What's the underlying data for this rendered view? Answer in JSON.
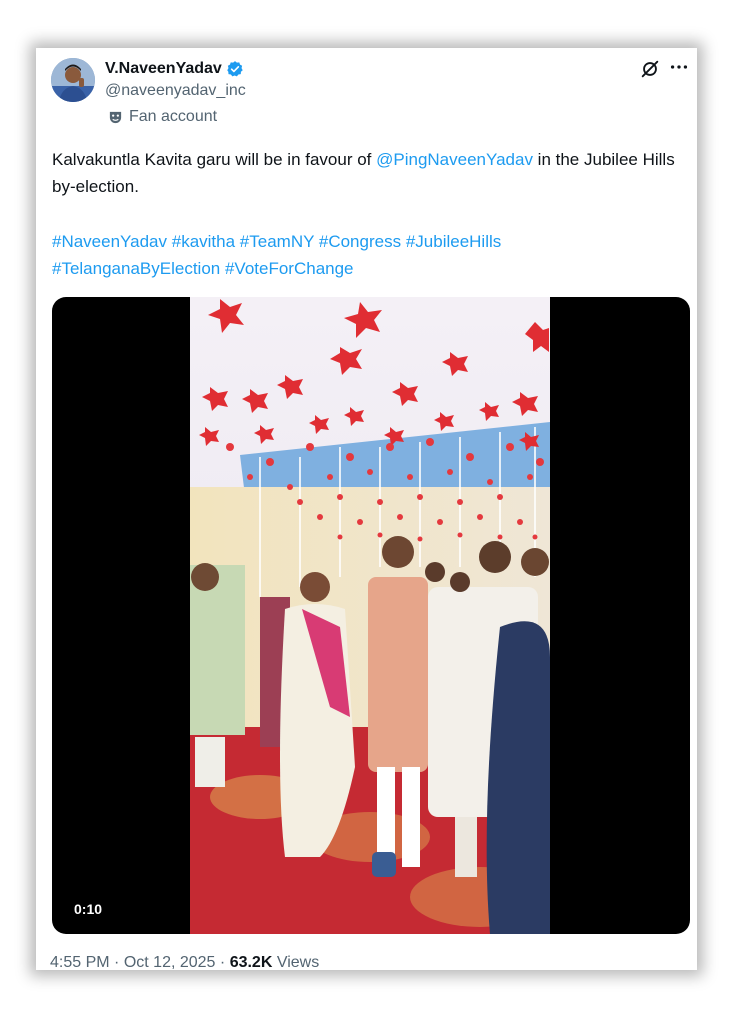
{
  "author": {
    "display_name": "V.NaveenYadav",
    "handle": "@naveenyadav_inc",
    "label": "Fan account",
    "avatar": "avatar-photo",
    "verified_icon": "verified-badge-icon"
  },
  "actions": {
    "grok_icon": "grok-icon",
    "more_icon": "more-options-icon"
  },
  "tweet": {
    "text_before": "Kalvakuntla Kavita garu will be in favour of ",
    "mention": "@PingNaveenYadav",
    "text_after": " in the Jubilee Hills by-election.",
    "hashtags": [
      "#NaveenYadav",
      "#kavitha",
      "#TeamNY",
      "#Congress",
      "#JubileeHills",
      "#TelanganaByElection",
      "#VoteForChange"
    ]
  },
  "media": {
    "duration": "0:10"
  },
  "meta": {
    "time": "4:55 PM",
    "separator": "·",
    "date": "Oct 12, 2025",
    "views_count": "63.2K",
    "views_label": "Views"
  },
  "colors": {
    "link": "#1d9bf0",
    "text": "#0f1419",
    "secondary": "#536471",
    "verified": "#1d9bf0"
  }
}
